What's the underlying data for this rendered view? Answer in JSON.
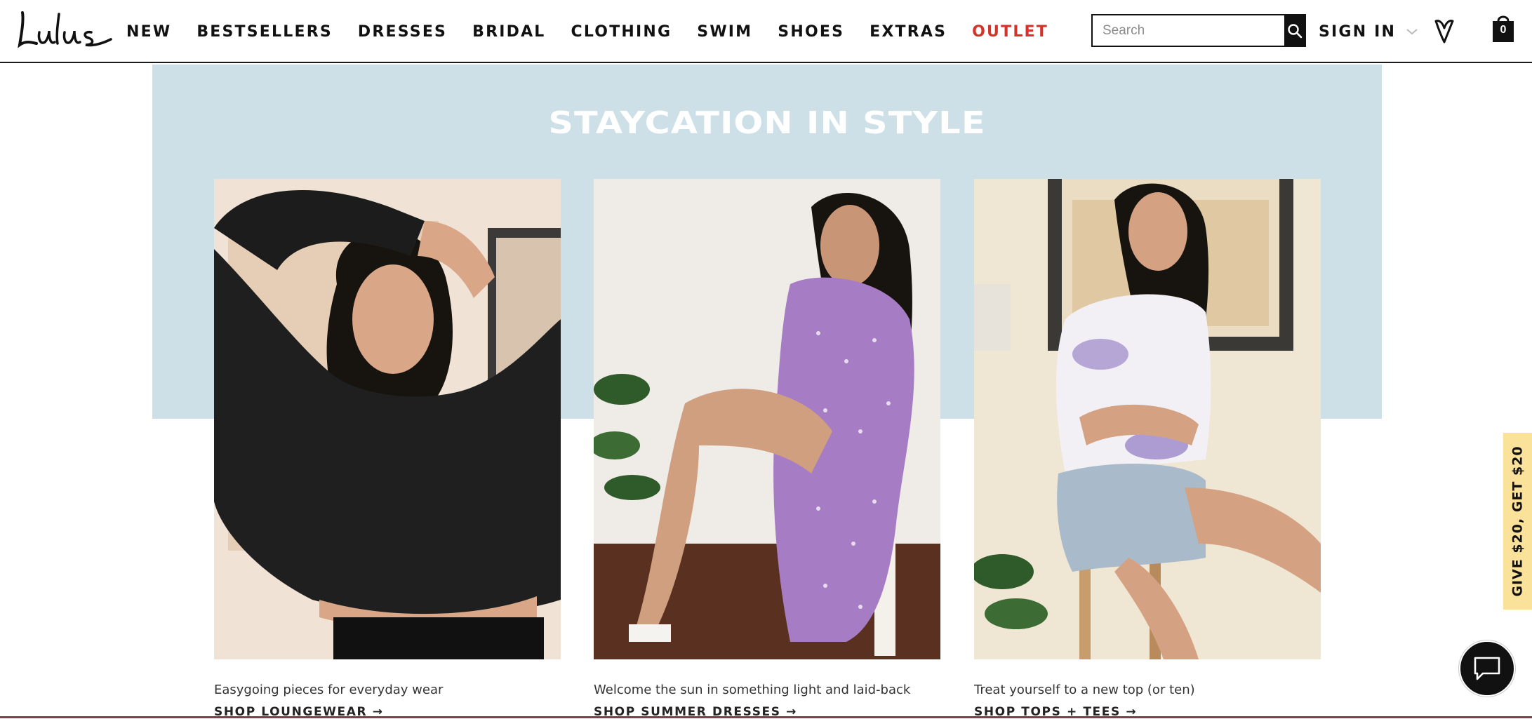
{
  "header": {
    "logo_text": "Lulus",
    "nav": [
      {
        "label": "NEW"
      },
      {
        "label": "BESTSELLERS"
      },
      {
        "label": "DRESSES"
      },
      {
        "label": "BRIDAL"
      },
      {
        "label": "CLOTHING"
      },
      {
        "label": "SWIM"
      },
      {
        "label": "SHOES"
      },
      {
        "label": "EXTRAS"
      },
      {
        "label": "OUTLET"
      }
    ],
    "search": {
      "placeholder": "Search",
      "value": ""
    },
    "sign_in": "SIGN IN",
    "bag_count": "0",
    "colors": {
      "outlet": "#d2342b",
      "text": "#111111"
    }
  },
  "hero": {
    "title": "STAYCATION IN STYLE",
    "background": "#cddfe7",
    "cards": [
      {
        "description": "Easygoing pieces for everyday wear",
        "link": "SHOP LOUNGEWEAR →",
        "image": "model-black-sweatshirt"
      },
      {
        "description": "Welcome the sun in something light and laid-back",
        "link": "SHOP SUMMER DRESSES →",
        "image": "model-purple-floral-dress"
      },
      {
        "description": "Treat yourself to a new top (or ten)",
        "link": "SHOP TOPS + TEES →",
        "image": "model-tie-dye-tee-denim-shorts"
      }
    ]
  },
  "side_tab": {
    "label": "GIVE $20, GET $20",
    "color": "#fbe29a"
  },
  "chat": {
    "icon": "chat-bubble-icon"
  }
}
